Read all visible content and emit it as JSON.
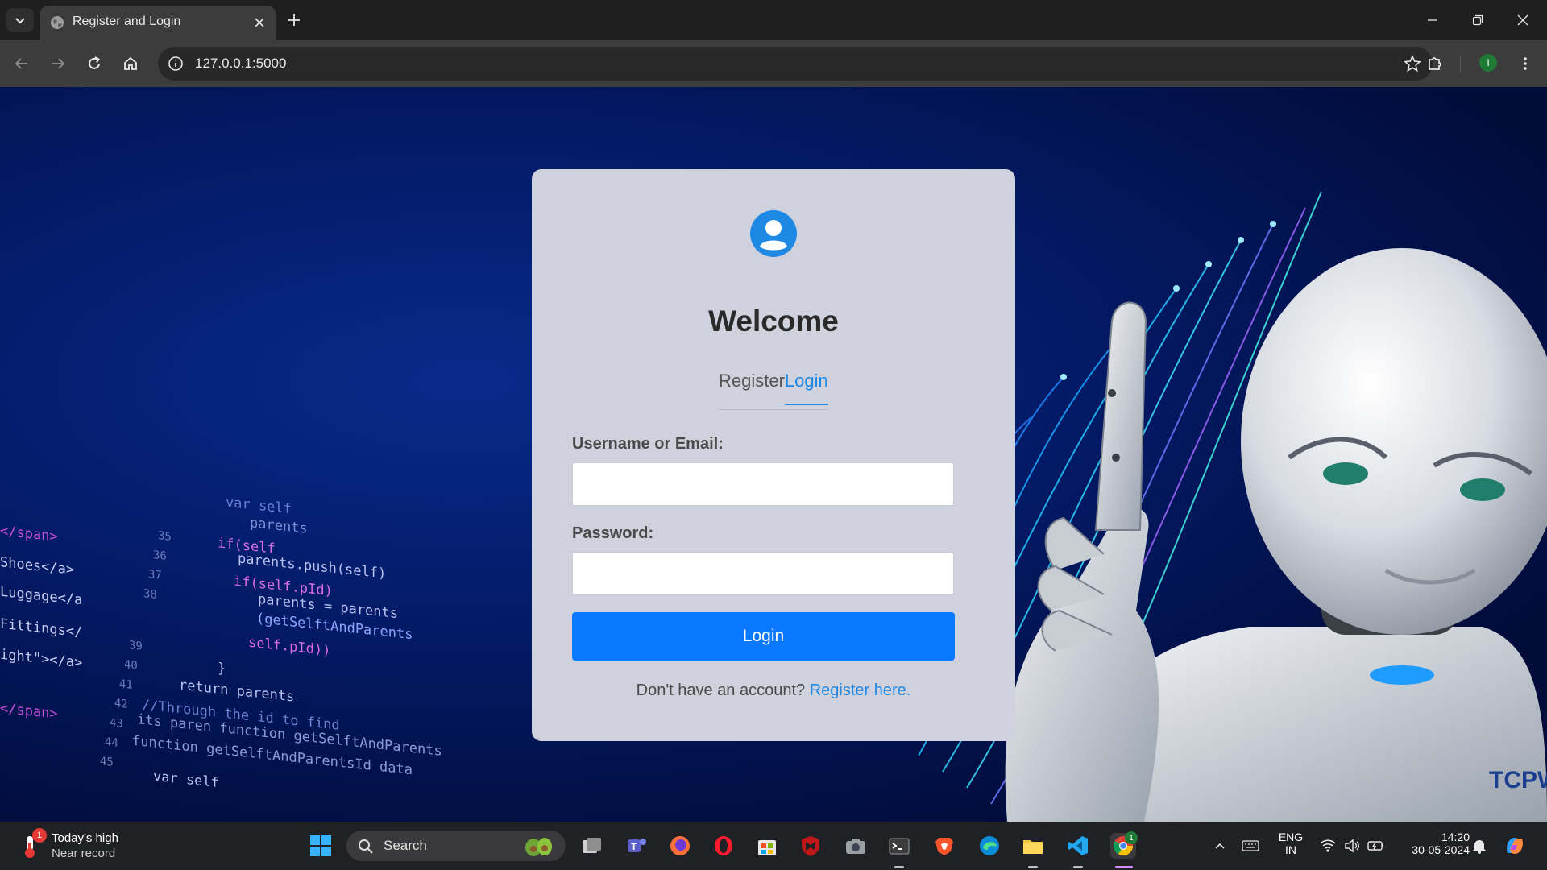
{
  "browser": {
    "tab_title": "Register and Login",
    "url": "127.0.0.1:5000",
    "profile_initial": "I"
  },
  "page": {
    "brand_text": "TCPWav",
    "code_lines": [
      "var self",
      "parents",
      "if(self",
      "parents.push(self)",
      "if(self.pId)",
      "parents = parents",
      "(getSelftAndParents",
      "self.pId))",
      "}",
      "return parents",
      "//Through the id to find",
      "its paren function getSelftAndParents",
      "function getSelftAndParentsId data",
      "var self"
    ],
    "html_lines": [
      "</span>",
      "Shoes</a>",
      "Luggage</a",
      "Fittings</",
      "ight\"></a>",
      "</span>"
    ],
    "line_numbers": [
      "35",
      "36",
      "37",
      "38",
      "39",
      "40",
      "41",
      "42",
      "43",
      "44",
      "45"
    ]
  },
  "card": {
    "title": "Welcome",
    "tabs": [
      {
        "label": "Register",
        "active": false
      },
      {
        "label": "Login",
        "active": true
      }
    ],
    "username_label": "Username or Email:",
    "username_value": "",
    "password_label": "Password:",
    "password_value": "",
    "submit_label": "Login",
    "switch_prompt": "Don't have an account?",
    "switch_link": "Register here."
  },
  "taskbar": {
    "weather_badge": "1",
    "weather_title": "Today's high",
    "weather_sub": "Near record",
    "search_label": "Search",
    "lang_top": "ENG",
    "lang_bottom": "IN",
    "time": "14:20",
    "date": "30-05-2024",
    "chrome_badge": "1"
  },
  "colors": {
    "accent": "#1e88e5",
    "button": "#0b79ff",
    "card_bg": "#cfd2dd",
    "page_bg": "#031a66"
  }
}
